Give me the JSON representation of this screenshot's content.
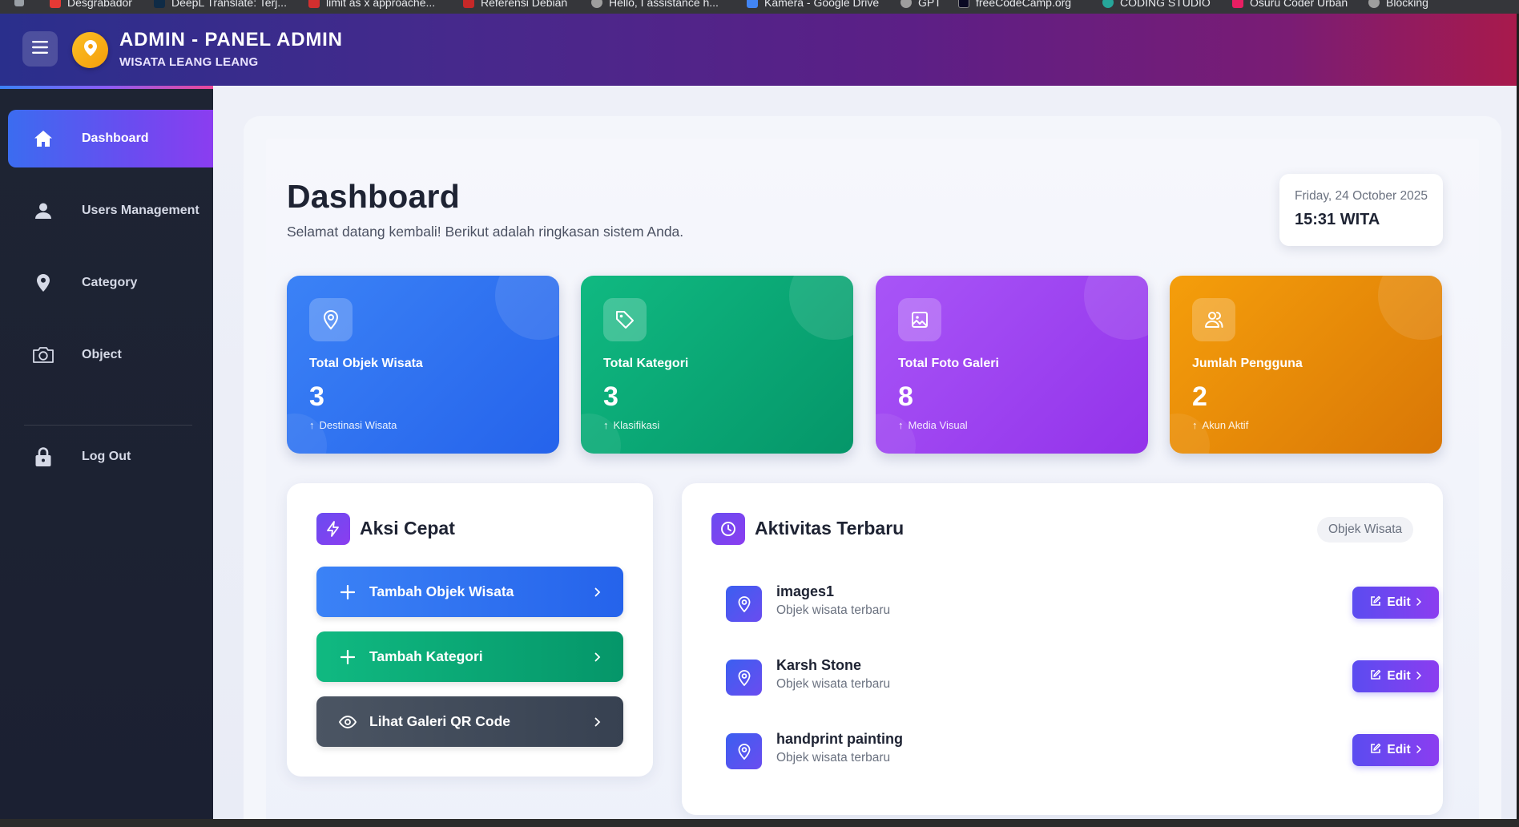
{
  "bookmarks": [
    {
      "label": "Desgrabador",
      "color": "#e53935"
    },
    {
      "label": "DeepL Translate: Terj...",
      "color": "#0f2b46"
    },
    {
      "label": "limit as x approache...",
      "color": "#d32f2f"
    },
    {
      "label": "Referensi Debian",
      "color": "#c62828"
    },
    {
      "label": "Hello, I assistance h...",
      "color": "#9e9e9e"
    },
    {
      "label": "Kamera - Google Drive",
      "color": "#4285f4"
    },
    {
      "label": "GPT",
      "color": "#9e9e9e"
    },
    {
      "label": "freeCodeCamp.org",
      "color": "#0a0a23"
    },
    {
      "label": "CODING STUDIO",
      "color": "#26a69a"
    },
    {
      "label": "Osuru Coder Urban",
      "color": "#e91e63"
    },
    {
      "label": "Blocking",
      "color": "#9e9e9e"
    }
  ],
  "header": {
    "title": "ADMIN - PANEL ADMIN",
    "subtitle": "WISATA LEANG LEANG",
    "menu_icon": "hamburger-icon",
    "logo_icon": "map-pin-icon"
  },
  "sidebar": {
    "items": [
      {
        "label": "Dashboard",
        "icon": "home-icon",
        "active": true
      },
      {
        "label": "Users Management",
        "icon": "user-icon",
        "active": false
      },
      {
        "label": "Category",
        "icon": "map-pin-icon",
        "active": false
      },
      {
        "label": "Object",
        "icon": "camera-icon",
        "active": false
      },
      {
        "label": "Log Out",
        "icon": "lock-icon",
        "active": false
      }
    ]
  },
  "page": {
    "title": "Dashboard",
    "subtitle": "Selamat datang kembali! Berikut adalah ringkasan sistem Anda.",
    "date": "Friday, 24 October 2025",
    "time": "15:31 WITA"
  },
  "stats": [
    {
      "label": "Total Objek Wisata",
      "value": "3",
      "note": "Destinasi Wisata",
      "icon": "map-pin-icon",
      "color_from": "#3b82f6",
      "color_to": "#2563eb"
    },
    {
      "label": "Total Kategori",
      "value": "3",
      "note": "Klasifikasi",
      "icon": "tag-icon",
      "color_from": "#10b981",
      "color_to": "#059669"
    },
    {
      "label": "Total Foto Galeri",
      "value": "8",
      "note": "Media Visual",
      "icon": "image-icon",
      "color_from": "#a855f7",
      "color_to": "#9333ea"
    },
    {
      "label": "Jumlah Pengguna",
      "value": "2",
      "note": "Akun Aktif",
      "icon": "users-icon",
      "color_from": "#f59e0b",
      "color_to": "#d97706"
    }
  ],
  "quick_actions": {
    "title": "Aksi Cepat",
    "icon": "lightning-icon",
    "buttons": [
      {
        "label": "Tambah Objek Wisata",
        "icon": "plus-icon",
        "color_from": "#3b82f6",
        "color_to": "#2563eb"
      },
      {
        "label": "Tambah Kategori",
        "icon": "plus-icon",
        "color_from": "#10b981",
        "color_to": "#059669"
      },
      {
        "label": "Lihat Galeri QR Code",
        "icon": "eye-icon",
        "color_from": "#4b5563",
        "color_to": "#374151"
      }
    ]
  },
  "activity": {
    "title": "Aktivitas Terbaru",
    "icon": "clock-icon",
    "filter": "Objek Wisata",
    "edit_label": "Edit",
    "items": [
      {
        "name": "images1",
        "subtitle": "Objek wisata terbaru"
      },
      {
        "name": "Karsh Stone",
        "subtitle": "Objek wisata terbaru"
      },
      {
        "name": "handprint painting",
        "subtitle": "Objek wisata terbaru"
      }
    ]
  }
}
